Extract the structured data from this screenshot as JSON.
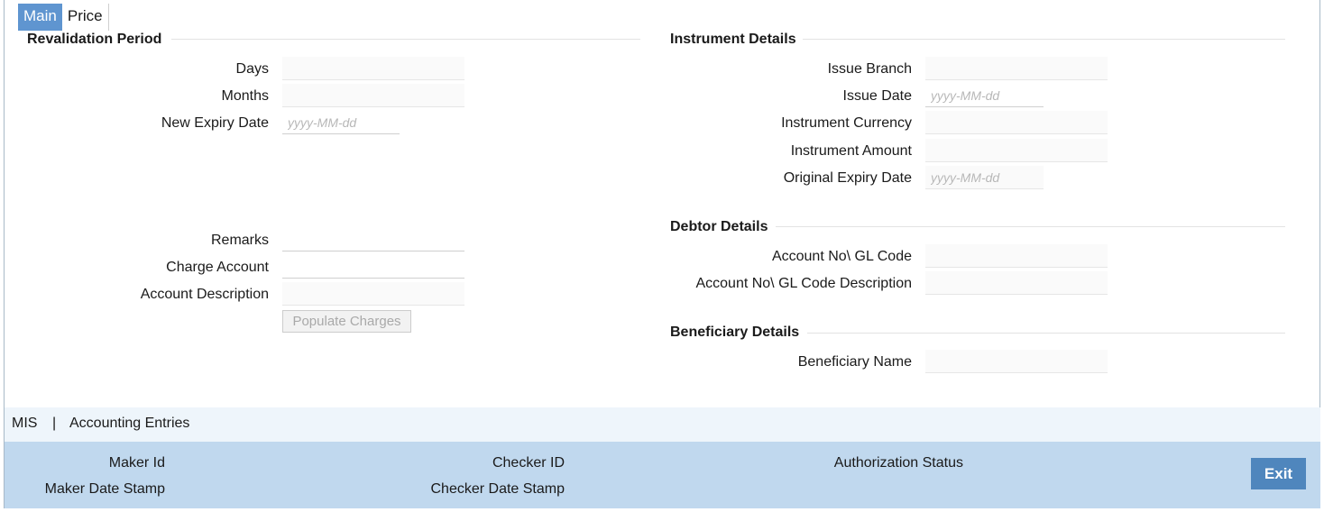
{
  "tabs": {
    "main": "Main",
    "price": "Price"
  },
  "revalidation": {
    "title": "Revalidation Period",
    "days_label": "Days",
    "days_value": "",
    "months_label": "Months",
    "months_value": "",
    "new_expiry_label": "New Expiry Date",
    "new_expiry_placeholder": "yyyy-MM-dd"
  },
  "charges": {
    "remarks_label": "Remarks",
    "remarks_value": "",
    "charge_account_label": "Charge Account",
    "charge_account_value": "",
    "account_desc_label": "Account Description",
    "account_desc_value": "",
    "populate_label": "Populate Charges"
  },
  "instrument": {
    "title": "Instrument Details",
    "issue_branch_label": "Issue Branch",
    "issue_branch_value": "",
    "issue_date_label": "Issue Date",
    "issue_date_placeholder": "yyyy-MM-dd",
    "currency_label": "Instrument Currency",
    "currency_value": "",
    "amount_label": "Instrument Amount",
    "amount_value": "",
    "orig_expiry_label": "Original Expiry Date",
    "orig_expiry_placeholder": "yyyy-MM-dd"
  },
  "debtor": {
    "title": "Debtor Details",
    "gl_code_label": "Account No\\ GL Code",
    "gl_code_value": "",
    "gl_desc_label": "Account No\\ GL Code Description",
    "gl_desc_value": ""
  },
  "beneficiary": {
    "title": "Beneficiary Details",
    "name_label": "Beneficiary Name",
    "name_value": ""
  },
  "links": {
    "mis": "MIS",
    "separator": "|",
    "accounting": "Accounting Entries"
  },
  "footer": {
    "maker_id": "Maker Id",
    "maker_date": "Maker Date Stamp",
    "checker_id": "Checker ID",
    "checker_date": "Checker Date Stamp",
    "auth_status": "Authorization Status",
    "exit": "Exit"
  }
}
